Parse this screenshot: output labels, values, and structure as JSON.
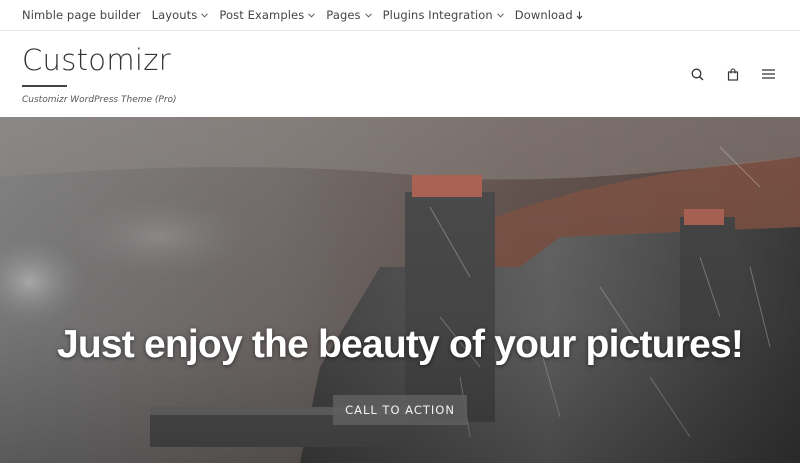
{
  "topnav": {
    "items": [
      {
        "label": "Nimble page builder",
        "has_caret": false
      },
      {
        "label": "Layouts",
        "has_caret": true
      },
      {
        "label": "Post Examples",
        "has_caret": true
      },
      {
        "label": "Pages",
        "has_caret": true
      },
      {
        "label": "Plugins Integration",
        "has_caret": true
      },
      {
        "label": "Download",
        "has_caret": false,
        "icon": "download-arrow-icon"
      }
    ]
  },
  "header": {
    "site_title": "Customizr",
    "tagline": "Customizr WordPress Theme (Pro)",
    "icons": [
      "search-icon",
      "shopping-bag-icon",
      "hamburger-menu-icon"
    ]
  },
  "hero": {
    "heading": "Just enjoy the beauty of your pictures!",
    "cta_label": "CALL TO ACTION"
  }
}
